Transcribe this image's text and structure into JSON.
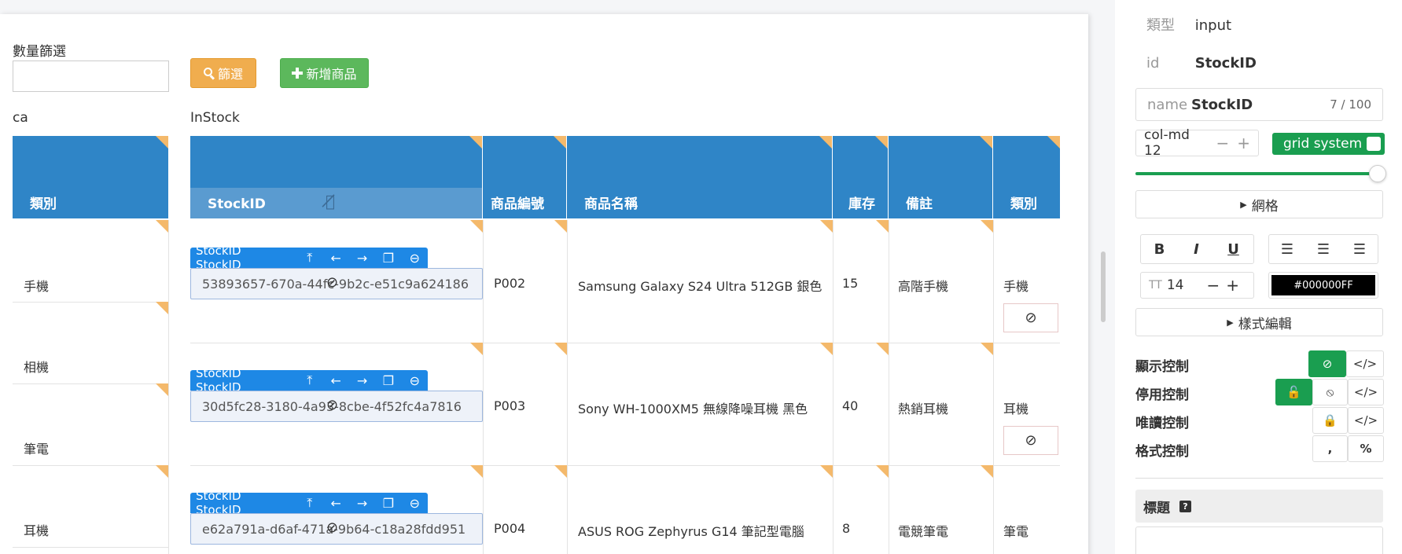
{
  "filter": {
    "label": "數量篩選",
    "value": "",
    "search_label": "篩選",
    "add_label": "新增商品"
  },
  "ca": {
    "title": "ca",
    "header": "類別",
    "rows": [
      "手機",
      "相機",
      "筆電",
      "耳機"
    ]
  },
  "instock": {
    "title": "InStock",
    "headers": [
      "StockID",
      "商品編號",
      "商品名稱",
      "庫存",
      "備註",
      "類別"
    ],
    "control_label": "StockID StockID",
    "rows": [
      {
        "id": "53893657-670a-44fc-9b2c-e51c9a624186",
        "code": "P002",
        "name": "Samsung Galaxy S24 Ultra 512GB 銀色",
        "stock": "15",
        "note": "高階手機",
        "cat": "手機"
      },
      {
        "id": "30d5fc28-3180-4a93-8cbe-4f52fc4a7816",
        "code": "P003",
        "name": "Sony WH-1000XM5 無線降噪耳機 黑色",
        "stock": "40",
        "note": "熱銷耳機",
        "cat": "耳機"
      },
      {
        "id": "e62a791a-d6af-471a-9b64-c18a28fdd951",
        "code": "P004",
        "name": "ASUS ROG Zephyrus G14 筆記型電腦",
        "stock": "8",
        "note": "電競筆電",
        "cat": "筆電"
      }
    ]
  },
  "panel": {
    "type_key": "類型",
    "type_val": "input",
    "id_key": "id",
    "id_val": "StockID",
    "name_key": "name",
    "name_val": "StockID",
    "name_count": "7 / 100",
    "colmd": "col-md 12",
    "grid_label": "grid system",
    "grid_section": "網格",
    "font_size": "14",
    "color_hex": "#000000FF",
    "style_section": "樣式編輯",
    "display_ctrl": "顯示控制",
    "disable_ctrl": "停用控制",
    "readonly_ctrl": "唯讀控制",
    "format_ctrl": "格式控制",
    "title_label": "標題"
  },
  "colors": {
    "header_blue": "#2f85c7",
    "accent_green": "#1a9e50",
    "search_orange": "#f0ad4e",
    "add_green": "#5cb85c",
    "control_blue": "#1e88e5"
  }
}
